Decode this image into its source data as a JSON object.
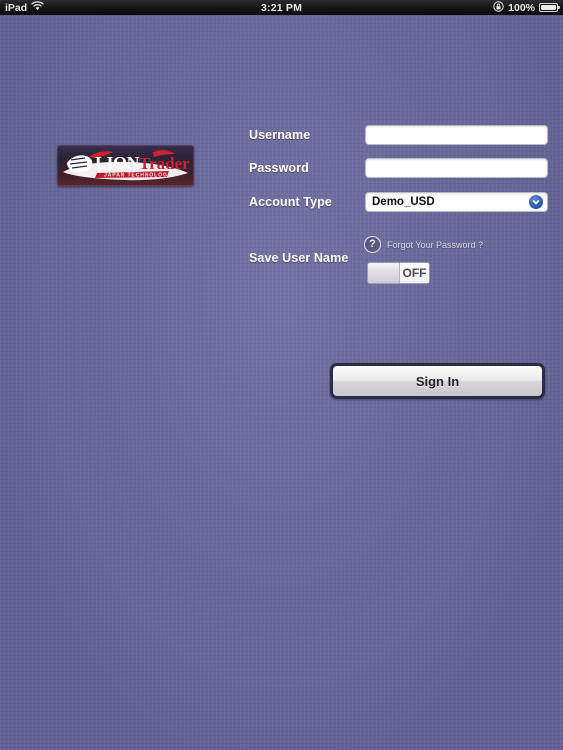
{
  "status_bar": {
    "carrier": "iPad",
    "wifi_icon": "wifi-icon",
    "time": "3:21 PM",
    "rotation_lock_icon": "rotation-lock-icon",
    "battery_percent": "100%",
    "battery_icon": "battery-icon"
  },
  "brand": {
    "logo_name": "lion-trader-logo",
    "word_lion": "LION",
    "word_trader": "Trader",
    "tagline": "JAPAN TECHNOLOGY"
  },
  "form": {
    "username": {
      "label": "Username",
      "value": "",
      "placeholder": ""
    },
    "password": {
      "label": "Password",
      "value": "",
      "placeholder": ""
    },
    "account_type": {
      "label": "Account Type",
      "selected": "Demo_USD",
      "chevron_icon": "chevron-down-icon"
    },
    "forgot_password": {
      "icon": "question-mark-icon",
      "text": "Forgot Your Password ?"
    },
    "save_user_name": {
      "label": "Save User Name",
      "state": "OFF"
    },
    "submit": {
      "label": "Sign In"
    }
  },
  "colors": {
    "background": "#6a6aa0",
    "status_bar": "#151517",
    "accent_blue": "#2e5fae",
    "logo_red": "#cf2233",
    "button_border": "#2b2b45"
  }
}
